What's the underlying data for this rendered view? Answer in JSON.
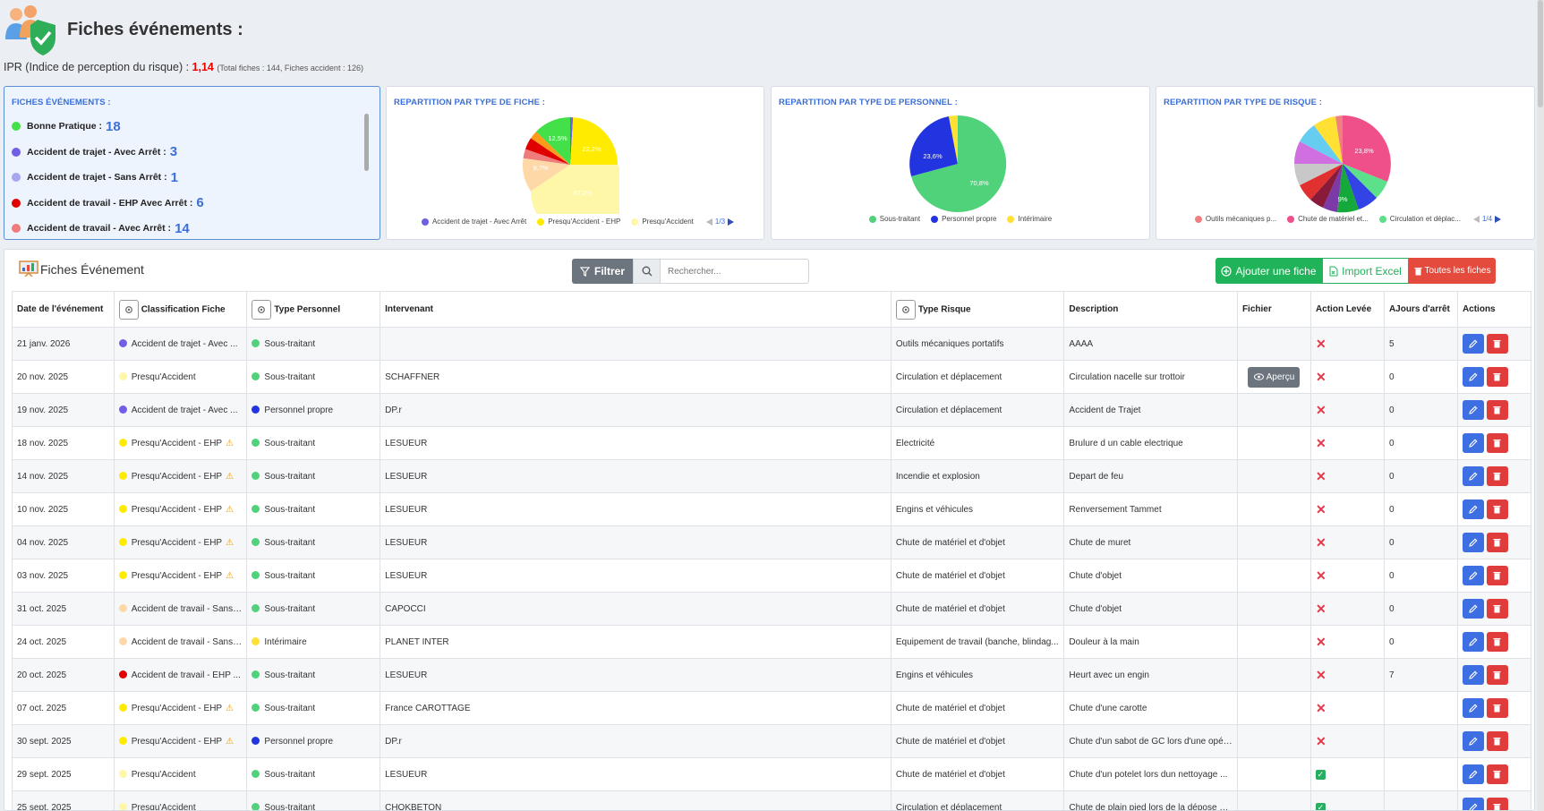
{
  "header": {
    "title": "Fiches événements :",
    "ipr_label": "IPR (Indice de perception du risque) :",
    "ipr_value": "1,14",
    "ipr_total": "(Total fiches : 144, Fiches accident : 126)"
  },
  "legend_card": {
    "title": "FICHES ÉVÉNEMENTS :",
    "items": [
      {
        "label": "Bonne Pratique :",
        "count": "18",
        "color": "#44e04a"
      },
      {
        "label": "Accident de trajet - Avec Arrêt :",
        "count": "3",
        "color": "#6f5fe6"
      },
      {
        "label": "Accident de trajet - Sans Arrêt :",
        "count": "1",
        "color": "#a7a7f0"
      },
      {
        "label": "Accident de travail - EHP Avec Arrêt :",
        "count": "6",
        "color": "#e00000"
      },
      {
        "label": "Accident de travail - Avec Arrêt :",
        "count": "14",
        "color": "#f07b7b"
      }
    ]
  },
  "pie_fiche": {
    "title": "REPARTITION PAR TYPE DE FICHE :",
    "labels": [
      "12,5%",
      "22,2%",
      "9,7%",
      "47,2%"
    ],
    "legend": [
      {
        "label": "Accident de trajet - Avec Arrêt",
        "color": "#6f5fe6"
      },
      {
        "label": "Presqu'Accident - EHP",
        "color": "#ffeb00"
      },
      {
        "label": "Presqu'Accident",
        "color": "#fff7a8"
      }
    ],
    "pager": "1/3"
  },
  "pie_perso": {
    "title": "REPARTITION PAR TYPE DE PERSONNEL :",
    "labels": [
      "23,6%",
      "70,8%"
    ],
    "legend": [
      {
        "label": "Sous-traitant",
        "color": "#4fd27a"
      },
      {
        "label": "Personnel propre",
        "color": "#2233e0"
      },
      {
        "label": "Intérimaire",
        "color": "#ffe033"
      }
    ]
  },
  "pie_risque": {
    "title": "REPARTITION PAR TYPE DE RISQUE :",
    "labels": [
      "23,8%",
      "9%"
    ],
    "legend": [
      {
        "label": "Outils mécaniques p...",
        "color": "#f08080"
      },
      {
        "label": "Chute de matériel et...",
        "color": "#f0508a"
      },
      {
        "label": "Circulation et déplac...",
        "color": "#5de08a"
      }
    ],
    "pager": "1/4"
  },
  "panel": {
    "title": "Fiches Événement",
    "filter_label": "Filtrer",
    "search_placeholder": "Rechercher...",
    "add_label": "Ajouter une fiche",
    "excel_label": "Import Excel",
    "all_label": "Toutes les fiches"
  },
  "columns": [
    "Date de l'événement",
    "Classification Fiche",
    "Type Personnel",
    "Intervenant",
    "Type Risque",
    "Description",
    "Fichier",
    "Action Levée",
    "AJours d'arrêt",
    "Actions"
  ],
  "apercu_label": "Aperçu",
  "rows": [
    {
      "date": "21 janv. 2026",
      "classif": "Accident de trajet - Avec ...",
      "ccolor": "#6f5fe6",
      "warn": false,
      "perso": "Sous-traitant",
      "pcolor": "#4fd27a",
      "interv": "",
      "risque": "Outils mécaniques portatifs",
      "desc": "AAAA",
      "file": false,
      "levee": "x",
      "jours": "5"
    },
    {
      "date": "20 nov. 2025",
      "classif": "Presqu'Accident",
      "ccolor": "#fff7a8",
      "warn": false,
      "perso": "Sous-traitant",
      "pcolor": "#4fd27a",
      "interv": "SCHAFFNER",
      "risque": "Circulation et déplacement",
      "desc": "Circulation nacelle sur trottoir",
      "file": true,
      "levee": "x",
      "jours": "0"
    },
    {
      "date": "19 nov. 2025",
      "classif": "Accident de trajet - Avec ...",
      "ccolor": "#6f5fe6",
      "warn": false,
      "perso": "Personnel propre",
      "pcolor": "#2233e0",
      "interv": "DP.r",
      "risque": "Circulation et déplacement",
      "desc": "Accident de Trajet",
      "file": false,
      "levee": "x",
      "jours": "0"
    },
    {
      "date": "18 nov. 2025",
      "classif": "Presqu'Accident - EHP",
      "ccolor": "#ffeb00",
      "warn": true,
      "perso": "Sous-traitant",
      "pcolor": "#4fd27a",
      "interv": "LESUEUR",
      "risque": "Electricité",
      "desc": "Brulure d un cable electrique",
      "file": false,
      "levee": "x",
      "jours": "0"
    },
    {
      "date": "14 nov. 2025",
      "classif": "Presqu'Accident - EHP",
      "ccolor": "#ffeb00",
      "warn": true,
      "perso": "Sous-traitant",
      "pcolor": "#4fd27a",
      "interv": "LESUEUR",
      "risque": "Incendie et explosion",
      "desc": "Depart de feu",
      "file": false,
      "levee": "x",
      "jours": "0"
    },
    {
      "date": "10 nov. 2025",
      "classif": "Presqu'Accident - EHP",
      "ccolor": "#ffeb00",
      "warn": true,
      "perso": "Sous-traitant",
      "pcolor": "#4fd27a",
      "interv": "LESUEUR",
      "risque": "Engins et véhicules",
      "desc": "Renversement Tammet",
      "file": false,
      "levee": "x",
      "jours": "0"
    },
    {
      "date": "04 nov. 2025",
      "classif": "Presqu'Accident - EHP",
      "ccolor": "#ffeb00",
      "warn": true,
      "perso": "Sous-traitant",
      "pcolor": "#4fd27a",
      "interv": "LESUEUR",
      "risque": "Chute de matériel et d'objet",
      "desc": "Chute de muret",
      "file": false,
      "levee": "x",
      "jours": "0"
    },
    {
      "date": "03 nov. 2025",
      "classif": "Presqu'Accident - EHP",
      "ccolor": "#ffeb00",
      "warn": true,
      "perso": "Sous-traitant",
      "pcolor": "#4fd27a",
      "interv": "LESUEUR",
      "risque": "Chute de matériel et d'objet",
      "desc": "Chute d'objet",
      "file": false,
      "levee": "x",
      "jours": "0"
    },
    {
      "date": "31 oct. 2025",
      "classif": "Accident de travail - Sans ...",
      "ccolor": "#ffd8a8",
      "warn": false,
      "perso": "Sous-traitant",
      "pcolor": "#4fd27a",
      "interv": "CAPOCCI",
      "risque": "Chute de matériel et d'objet",
      "desc": "Chute d'objet",
      "file": false,
      "levee": "x",
      "jours": "0"
    },
    {
      "date": "24 oct. 2025",
      "classif": "Accident de travail - Sans ...",
      "ccolor": "#ffd8a8",
      "warn": false,
      "perso": "Intérimaire",
      "pcolor": "#ffe033",
      "interv": "PLANET INTER",
      "risque": "Equipement de travail (banche, blindag...",
      "desc": "Douleur à la main",
      "file": false,
      "levee": "x",
      "jours": "0"
    },
    {
      "date": "20 oct. 2025",
      "classif": "Accident de travail - EHP ...",
      "ccolor": "#e00000",
      "warn": false,
      "perso": "Sous-traitant",
      "pcolor": "#4fd27a",
      "interv": "LESUEUR",
      "risque": "Engins et véhicules",
      "desc": "Heurt avec un engin",
      "file": false,
      "levee": "x",
      "jours": "7"
    },
    {
      "date": "07 oct. 2025",
      "classif": "Presqu'Accident - EHP",
      "ccolor": "#ffeb00",
      "warn": true,
      "perso": "Sous-traitant",
      "pcolor": "#4fd27a",
      "interv": "France CAROTTAGE",
      "risque": "Chute de matériel et d'objet",
      "desc": "Chute d'une carotte",
      "file": false,
      "levee": "x",
      "jours": ""
    },
    {
      "date": "30 sept. 2025",
      "classif": "Presqu'Accident - EHP",
      "ccolor": "#ffeb00",
      "warn": true,
      "perso": "Personnel propre",
      "pcolor": "#2233e0",
      "interv": "DP.r",
      "risque": "Chute de matériel et d'objet",
      "desc": "Chute d'un sabot de GC lors d'une opér...",
      "file": false,
      "levee": "x",
      "jours": ""
    },
    {
      "date": "29 sept. 2025",
      "classif": "Presqu'Accident",
      "ccolor": "#fff7a8",
      "warn": false,
      "perso": "Sous-traitant",
      "pcolor": "#4fd27a",
      "interv": "LESUEUR",
      "risque": "Chute de matériel et d'objet",
      "desc": "Chute d'un potelet lors dun nettoyage ...",
      "file": false,
      "levee": "check",
      "jours": ""
    },
    {
      "date": "25 sept. 2025",
      "classif": "Presqu'Accident",
      "ccolor": "#fff7a8",
      "warn": false,
      "perso": "Sous-traitant",
      "pcolor": "#4fd27a",
      "interv": "CHOKBETON",
      "risque": "Circulation et déplacement",
      "desc": "Chute de plain pied lors de la dépose d'...",
      "file": false,
      "levee": "check",
      "jours": ""
    }
  ]
}
